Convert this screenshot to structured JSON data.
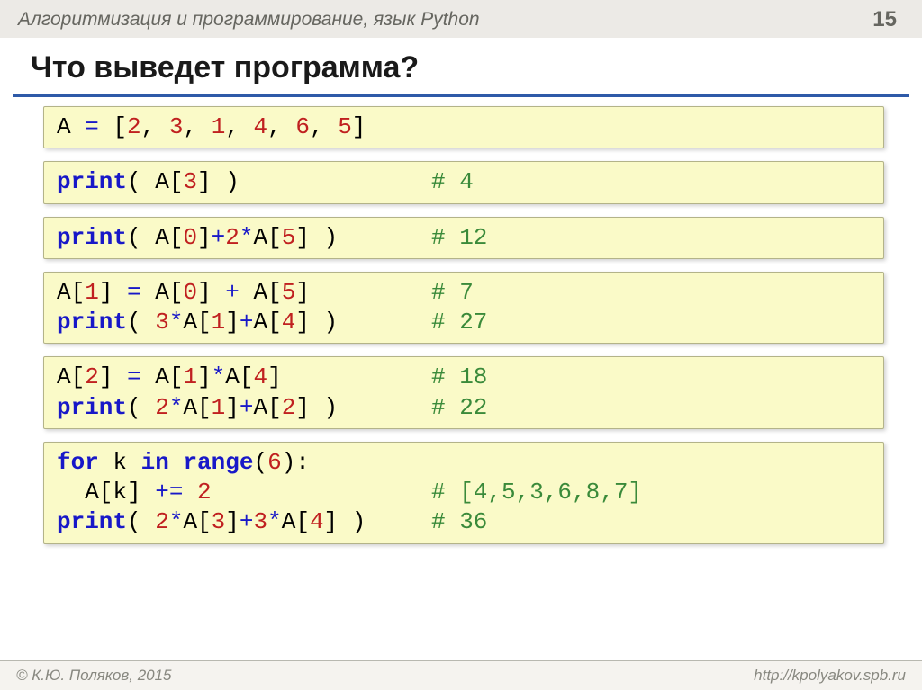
{
  "header": {
    "course_title": "Алгоритмизация и программирование, язык Python",
    "page_number": "15"
  },
  "slide_title": "Что выведет программа?",
  "boxes": [
    {
      "lines": [
        {
          "segs": [
            {
              "t": "A ",
              "c": "txt"
            },
            {
              "t": "=",
              "c": "sym"
            },
            {
              "t": " [",
              "c": "txt"
            },
            {
              "t": "2",
              "c": "num"
            },
            {
              "t": ", ",
              "c": "txt"
            },
            {
              "t": "3",
              "c": "num"
            },
            {
              "t": ", ",
              "c": "txt"
            },
            {
              "t": "1",
              "c": "num"
            },
            {
              "t": ", ",
              "c": "txt"
            },
            {
              "t": "4",
              "c": "num"
            },
            {
              "t": ", ",
              "c": "txt"
            },
            {
              "t": "6",
              "c": "num"
            },
            {
              "t": ", ",
              "c": "txt"
            },
            {
              "t": "5",
              "c": "num"
            },
            {
              "t": "]",
              "c": "txt"
            }
          ]
        }
      ]
    },
    {
      "lines": [
        {
          "segs": [
            {
              "t": "print",
              "c": "kw"
            },
            {
              "t": "( A[",
              "c": "txt"
            },
            {
              "t": "3",
              "c": "num"
            },
            {
              "t": "] )",
              "c": "txt"
            }
          ],
          "comment": "# 4"
        }
      ]
    },
    {
      "lines": [
        {
          "segs": [
            {
              "t": "print",
              "c": "kw"
            },
            {
              "t": "( A[",
              "c": "txt"
            },
            {
              "t": "0",
              "c": "num"
            },
            {
              "t": "]",
              "c": "txt"
            },
            {
              "t": "+",
              "c": "sym"
            },
            {
              "t": "2",
              "c": "num"
            },
            {
              "t": "*",
              "c": "sym"
            },
            {
              "t": "A[",
              "c": "txt"
            },
            {
              "t": "5",
              "c": "num"
            },
            {
              "t": "] )",
              "c": "txt"
            }
          ],
          "comment": "# 12"
        }
      ]
    },
    {
      "lines": [
        {
          "segs": [
            {
              "t": "A[",
              "c": "txt"
            },
            {
              "t": "1",
              "c": "num"
            },
            {
              "t": "] ",
              "c": "txt"
            },
            {
              "t": "=",
              "c": "sym"
            },
            {
              "t": " A[",
              "c": "txt"
            },
            {
              "t": "0",
              "c": "num"
            },
            {
              "t": "] ",
              "c": "txt"
            },
            {
              "t": "+",
              "c": "sym"
            },
            {
              "t": " A[",
              "c": "txt"
            },
            {
              "t": "5",
              "c": "num"
            },
            {
              "t": "]",
              "c": "txt"
            }
          ],
          "comment": "# 7"
        },
        {
          "segs": [
            {
              "t": "print",
              "c": "kw"
            },
            {
              "t": "( ",
              "c": "txt"
            },
            {
              "t": "3",
              "c": "num"
            },
            {
              "t": "*",
              "c": "sym"
            },
            {
              "t": "A[",
              "c": "txt"
            },
            {
              "t": "1",
              "c": "num"
            },
            {
              "t": "]",
              "c": "txt"
            },
            {
              "t": "+",
              "c": "sym"
            },
            {
              "t": "A[",
              "c": "txt"
            },
            {
              "t": "4",
              "c": "num"
            },
            {
              "t": "] )",
              "c": "txt"
            }
          ],
          "comment": "# 27"
        }
      ]
    },
    {
      "lines": [
        {
          "segs": [
            {
              "t": "A[",
              "c": "txt"
            },
            {
              "t": "2",
              "c": "num"
            },
            {
              "t": "] ",
              "c": "txt"
            },
            {
              "t": "=",
              "c": "sym"
            },
            {
              "t": " A[",
              "c": "txt"
            },
            {
              "t": "1",
              "c": "num"
            },
            {
              "t": "]",
              "c": "txt"
            },
            {
              "t": "*",
              "c": "sym"
            },
            {
              "t": "A[",
              "c": "txt"
            },
            {
              "t": "4",
              "c": "num"
            },
            {
              "t": "]",
              "c": "txt"
            }
          ],
          "comment": "# 18"
        },
        {
          "segs": [
            {
              "t": "print",
              "c": "kw"
            },
            {
              "t": "( ",
              "c": "txt"
            },
            {
              "t": "2",
              "c": "num"
            },
            {
              "t": "*",
              "c": "sym"
            },
            {
              "t": "A[",
              "c": "txt"
            },
            {
              "t": "1",
              "c": "num"
            },
            {
              "t": "]",
              "c": "txt"
            },
            {
              "t": "+",
              "c": "sym"
            },
            {
              "t": "A[",
              "c": "txt"
            },
            {
              "t": "2",
              "c": "num"
            },
            {
              "t": "] )",
              "c": "txt"
            }
          ],
          "comment": "# 22"
        }
      ]
    },
    {
      "lines": [
        {
          "segs": [
            {
              "t": "for",
              "c": "kw"
            },
            {
              "t": " k ",
              "c": "txt"
            },
            {
              "t": "in",
              "c": "kw"
            },
            {
              "t": " ",
              "c": "txt"
            },
            {
              "t": "range",
              "c": "kw"
            },
            {
              "t": "(",
              "c": "txt"
            },
            {
              "t": "6",
              "c": "num"
            },
            {
              "t": "):",
              "c": "txt"
            }
          ]
        },
        {
          "segs": [
            {
              "t": "  A[k] ",
              "c": "txt"
            },
            {
              "t": "+=",
              "c": "sym"
            },
            {
              "t": " ",
              "c": "txt"
            },
            {
              "t": "2",
              "c": "num"
            }
          ],
          "comment": "# [4,5,3,6,8,7]"
        },
        {
          "segs": [
            {
              "t": "print",
              "c": "kw"
            },
            {
              "t": "( ",
              "c": "txt"
            },
            {
              "t": "2",
              "c": "num"
            },
            {
              "t": "*",
              "c": "sym"
            },
            {
              "t": "A[",
              "c": "txt"
            },
            {
              "t": "3",
              "c": "num"
            },
            {
              "t": "]",
              "c": "txt"
            },
            {
              "t": "+",
              "c": "sym"
            },
            {
              "t": "3",
              "c": "num"
            },
            {
              "t": "*",
              "c": "sym"
            },
            {
              "t": "A[",
              "c": "txt"
            },
            {
              "t": "4",
              "c": "num"
            },
            {
              "t": "] )",
              "c": "txt"
            }
          ],
          "comment": "# 36"
        }
      ]
    }
  ],
  "footer": {
    "copyright": "© К.Ю. Поляков, 2015",
    "url": "http://kpolyakov.spb.ru"
  }
}
